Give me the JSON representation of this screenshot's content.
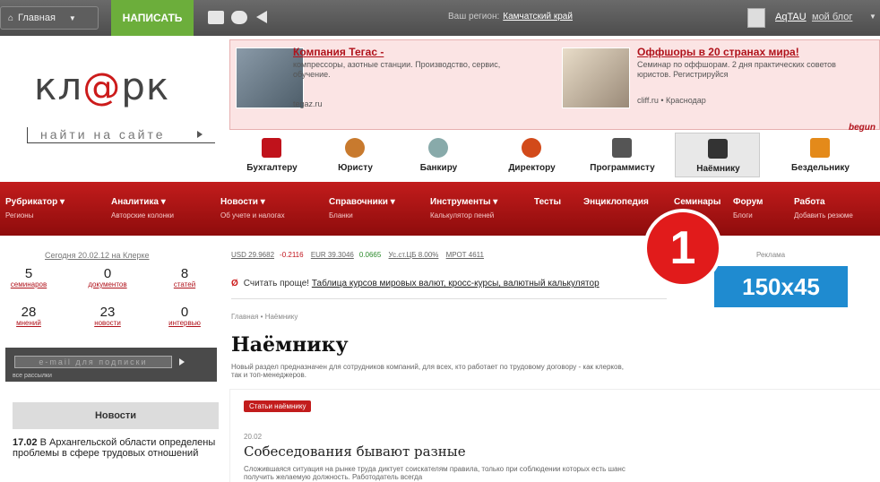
{
  "topbar": {
    "home_label": "Главная",
    "write_label": "НАПИСАТЬ",
    "region_prefix": "Ваш регион:",
    "region": "Камчатский край",
    "user": "AqTAU",
    "blog": "мой блог"
  },
  "logo": {
    "text_left": "кл",
    "text_right": "рк"
  },
  "search": {
    "placeholder": "найти на сайте"
  },
  "ads": [
    {
      "title": "Компания Тегас -",
      "text": "компрессоры, азотные станции. Производство, сервис, обучение.",
      "link": "tegaz.ru"
    },
    {
      "title": "Оффшоры в 20 странах мира!",
      "text": "Семинар по оффшорам. 2 дня практических советов юристов. Регистрируйся",
      "link": "cliff.ru • Краснодар"
    }
  ],
  "begun": "begun",
  "categories": [
    {
      "label": "Бухгалтеру",
      "color": "#c0121b"
    },
    {
      "label": "Юристу",
      "color": "#c87a2e"
    },
    {
      "label": "Банкиру",
      "color": "#8aa"
    },
    {
      "label": "Директору",
      "color": "#d24a1a"
    },
    {
      "label": "Программисту",
      "color": "#555"
    },
    {
      "label": "Наёмнику",
      "color": "#333"
    },
    {
      "label": "Бездельнику",
      "color": "#e48a1a"
    }
  ],
  "nav": [
    {
      "label": "Рубрикатор ▾",
      "sub": "Регионы"
    },
    {
      "label": "Аналитика ▾",
      "sub": "Авторские колонки"
    },
    {
      "label": "Новости ▾",
      "sub": "Об учете и налогах"
    },
    {
      "label": "Справочники ▾",
      "sub": "Бланки"
    },
    {
      "label": "Инструменты ▾",
      "sub": "Калькулятор пеней"
    },
    {
      "label": "Тесты",
      "sub": ""
    },
    {
      "label": "Энциклопедия",
      "sub": ""
    },
    {
      "label": "Семинары",
      "sub": ""
    },
    {
      "label": "Форум",
      "sub": "Блоги"
    },
    {
      "label": "Работа",
      "sub": "Добавить резюме"
    }
  ],
  "date": {
    "text": "Сегодня 20.02.12 на Клерке"
  },
  "stats": [
    {
      "n": "5",
      "label": "семинаров"
    },
    {
      "n": "0",
      "label": "документов"
    },
    {
      "n": "8",
      "label": "статей"
    },
    {
      "n": "28",
      "label": "мнений"
    },
    {
      "n": "23",
      "label": "новости"
    },
    {
      "n": "0",
      "label": "интервью"
    }
  ],
  "email": {
    "placeholder": "e-mail для подписки",
    "sub": "все рассылки"
  },
  "news": {
    "header": "Новости",
    "date": "17.02",
    "text": "В Архангельской области определены проблемы в сфере трудовых отношений"
  },
  "rates": {
    "usd": "USD 29.9682",
    "usd_change": "-0.2116",
    "eur": "EUR 39.3046",
    "eur_change": "0.0665",
    "cb": "Ус.ст.ЦБ 8.00%",
    "mrot": "МРОТ 4611"
  },
  "ad_label": "Реклама",
  "currency": {
    "prefix": "Считать проще!",
    "text": "Таблица курсов мировых валют, кросс-курсы, валютный калькулятор"
  },
  "breadcrumbs": "Главная • Наёмнику",
  "page": {
    "title": "Наёмнику",
    "description": "Новый раздел предназначен для сотрудников компаний, для всех, кто работает по трудовому договору - как клерков, так и топ-менеджеров."
  },
  "article": {
    "badge": "Статьи наёмнику",
    "date": "20.02",
    "title": "Собеседования бывают разные",
    "text": "Сложившаяся ситуация на рынке труда диктует соискателям правила, только при соблюдении которых есть шанс получить желаемую должность. Работодатель всегда"
  },
  "overlay": {
    "badge_number": "1",
    "banner": "150x45"
  }
}
